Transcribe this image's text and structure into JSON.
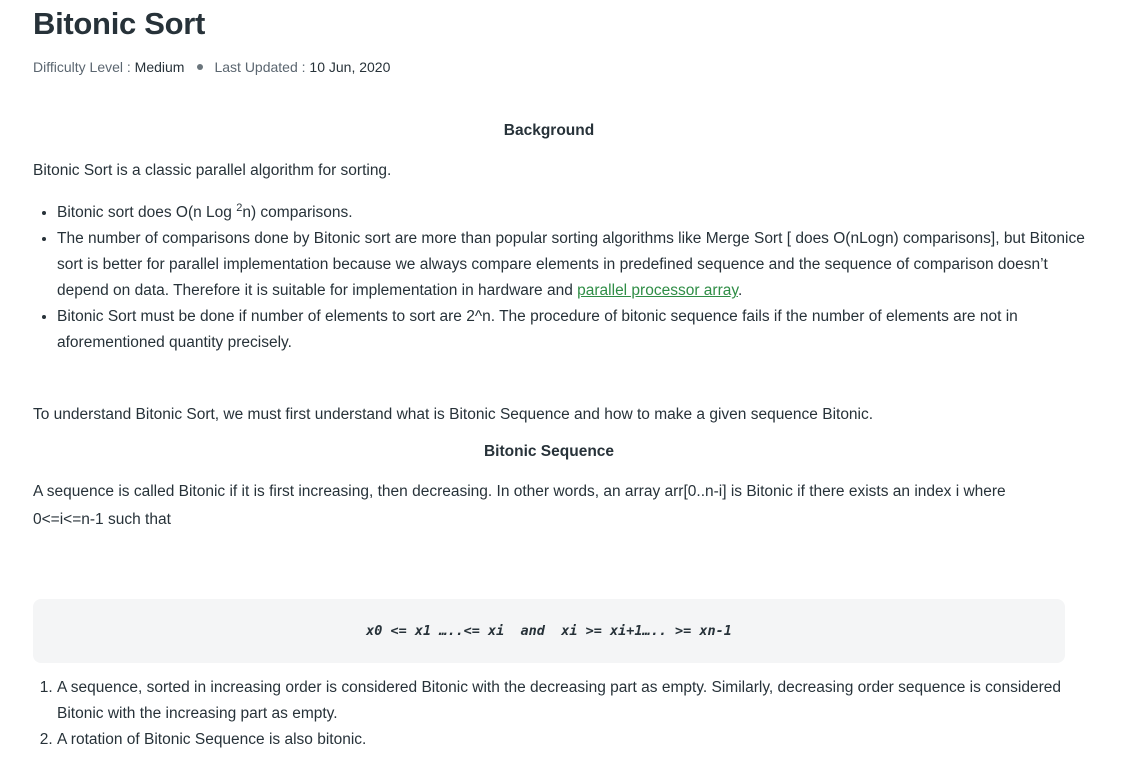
{
  "article": {
    "title": "Bitonic Sort",
    "meta": {
      "difficulty_label": "Difficulty Level : ",
      "difficulty_value": "Medium",
      "updated_label": "Last Updated : ",
      "updated_value": "10 Jun, 2020"
    }
  },
  "background": {
    "heading": "Background",
    "intro": "Bitonic Sort is a classic parallel algorithm for sorting.",
    "bullets": {
      "b1_pre": "Bitonic sort does O(n Log ",
      "b1_sup": "2",
      "b1_post": "n) comparisons.",
      "b2_text": "The number of comparisons done by Bitonic sort are more than popular sorting algorithms like Merge Sort [ does O(nLogn) comparisons], but Bitonice sort is better for parallel implementation because we always compare elements in predefined sequence and the sequence of comparison doesn’t depend on data. Therefore it is suitable for implementation in hardware and ",
      "b2_link": "parallel processor array",
      "b2_end": ".",
      "b3_text": "Bitonic Sort must be done if number of elements to sort are 2^n. The procedure of bitonic sequence fails if the number of elements are not in aforementioned quantity precisely."
    },
    "closing": "To understand Bitonic Sort, we must first understand what is Bitonic Sequence and how to make a given sequence Bitonic."
  },
  "sequence": {
    "heading": "Bitonic Sequence",
    "definition": "A sequence is called Bitonic if it is first increasing, then decreasing. In other words, an array arr[0..n-i] is Bitonic if there exists an index i where 0<=i<=n-1 such that",
    "formula": "x0 <= x1 …..<= xi  and  xi >= xi+1….. >= xn-1",
    "notes": [
      "A sequence, sorted in increasing order is considered Bitonic with the decreasing part as empty. Similarly, decreasing order sequence is considered Bitonic with the increasing part as empty.",
      "A rotation of Bitonic Sequence is also bitonic."
    ]
  }
}
